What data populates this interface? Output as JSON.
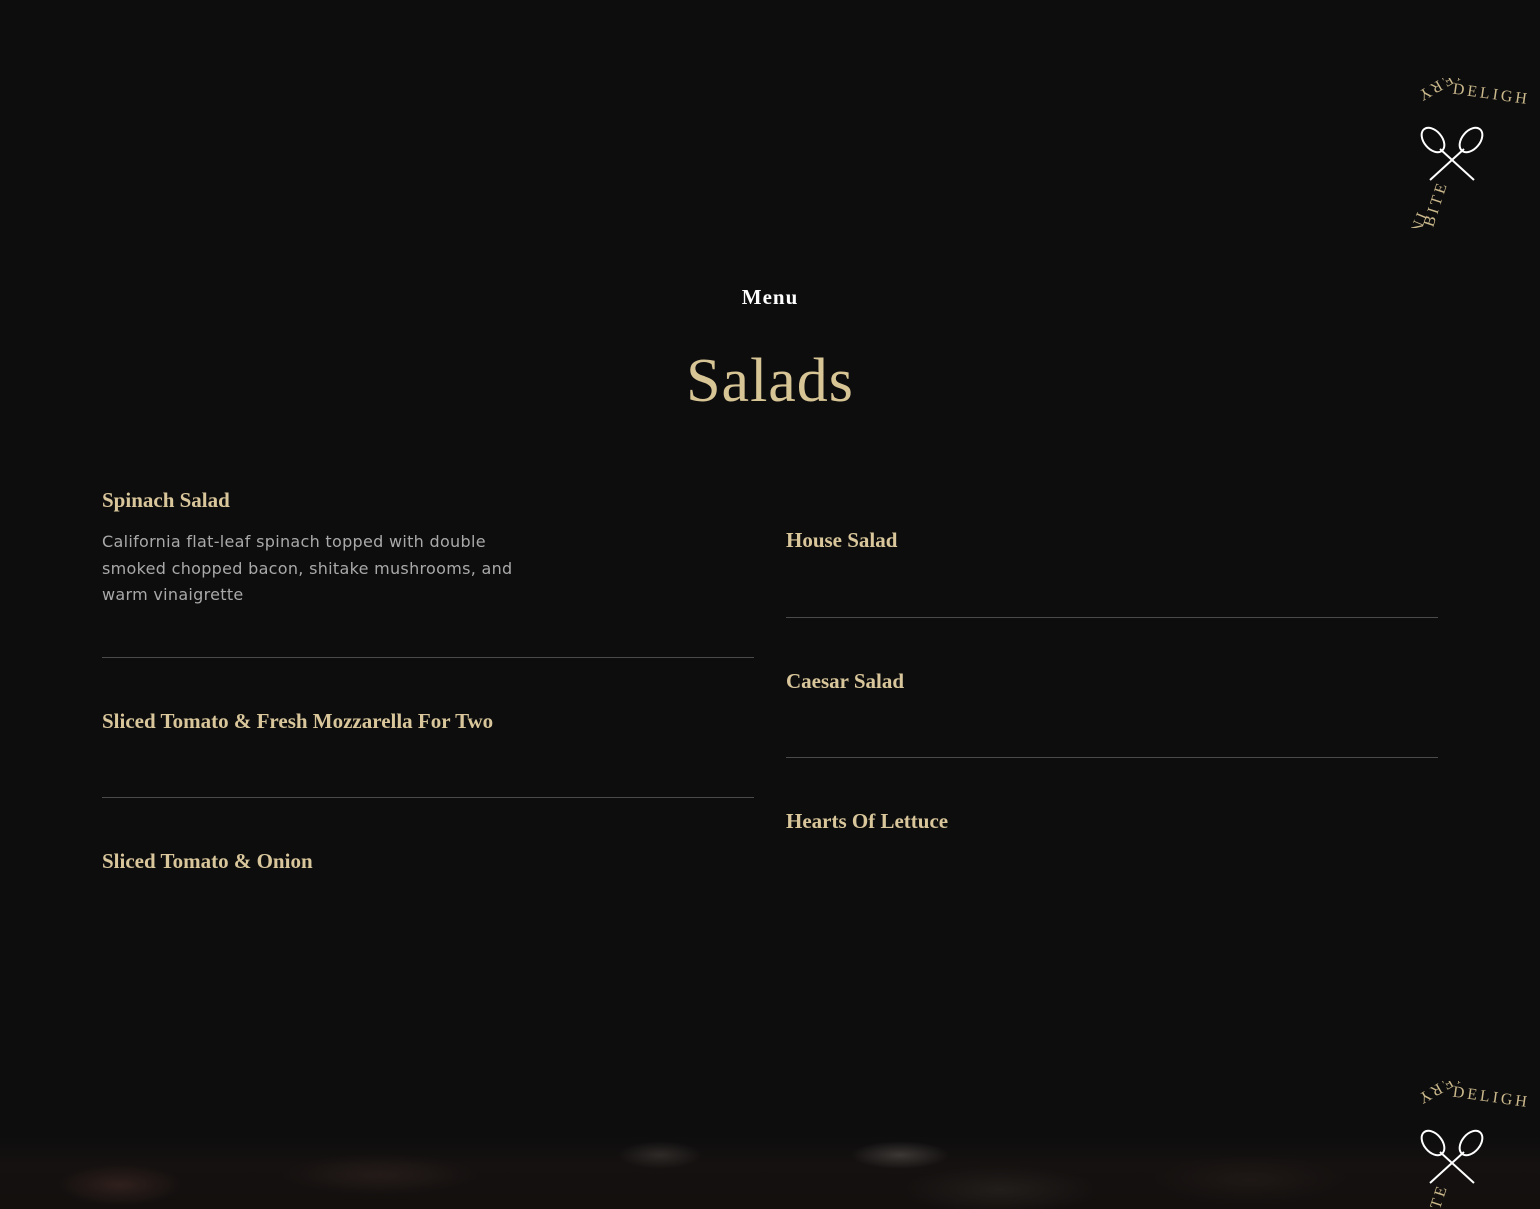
{
  "badge": {
    "text_top": "DELIGHT",
    "text_left": "BITE",
    "text_bottom_left": "EVERY",
    "text_right": "IN",
    "icon": "crossed-spoons-icon"
  },
  "header": {
    "eyebrow": "Menu",
    "title": "Salads"
  },
  "colors": {
    "background": "#0d0d0e",
    "gold": "#d9c79b",
    "description": "#a9a9a9",
    "divider": "#4a4a4a"
  },
  "menu": {
    "left": [
      {
        "name": "Spinach Salad",
        "description": "California flat-leaf spinach topped with double smoked chopped bacon, shitake mushrooms, and warm vinaigrette"
      },
      {
        "name": "Sliced Tomato & Fresh Mozzarella For Two"
      },
      {
        "name": "Sliced Tomato & Onion"
      }
    ],
    "right": [
      {
        "name": "House Salad"
      },
      {
        "name": "Caesar Salad"
      },
      {
        "name": "Hearts Of Lettuce"
      }
    ]
  }
}
